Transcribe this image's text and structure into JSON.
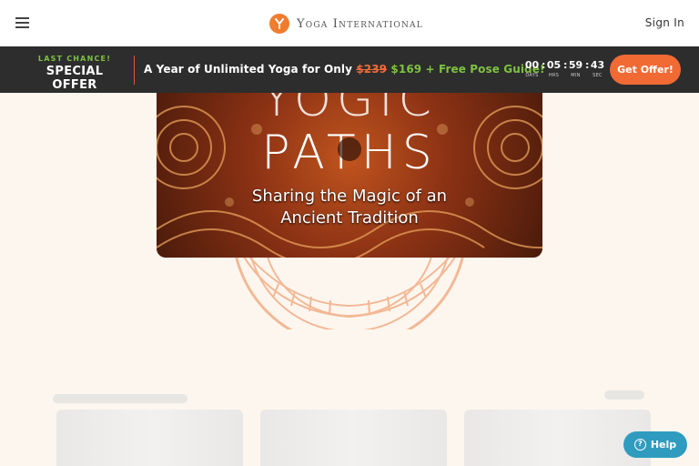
{
  "header": {
    "logo_text": "Yoga International",
    "logo_mark": "Y",
    "signin_label": "Sign In"
  },
  "promo": {
    "last_chance": "LAST CHANCE!",
    "special_offer": "SPECIAL OFFER",
    "text_prefix": "A Year of Unlimited Yoga for Only ",
    "old_price": "$239",
    "new_price": "$169",
    "text_suffix": " + Free Pose Guide!",
    "countdown": {
      "days": "00",
      "hrs": "05",
      "min": "59",
      "sec": "43",
      "days_label": "DAYS",
      "hrs_label": "HRS",
      "min_label": "MIN",
      "sec_label": "SEC"
    },
    "offer_button": "Get Offer!"
  },
  "hero": {
    "title_line1": "YOGIC",
    "title_line2": "PATHS",
    "subtitle_line1": "Sharing the Magic of an",
    "subtitle_line2": "Ancient Tradition"
  },
  "help": {
    "label": "Help",
    "icon_glyph": "?"
  },
  "colors": {
    "accent_orange": "#f16a34",
    "promo_green": "#7dc242",
    "promo_bg": "#2d2d2d",
    "page_bg": "#fdf6ee",
    "help_blue": "#2f9cbf"
  },
  "icons": [
    "hamburger-icon",
    "logo-icon",
    "help-icon",
    "play-icon"
  ]
}
